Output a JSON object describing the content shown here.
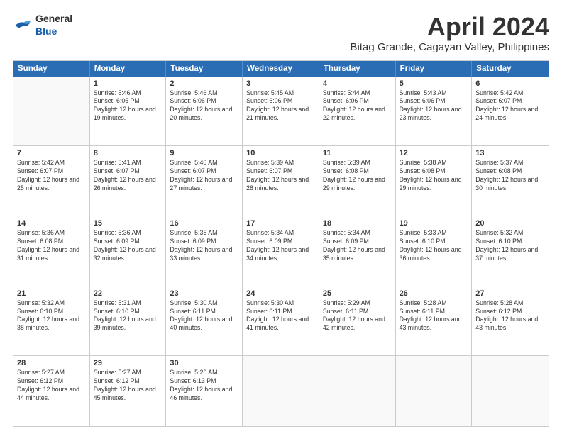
{
  "header": {
    "logo_general": "General",
    "logo_blue": "Blue",
    "month_year": "April 2024",
    "location": "Bitag Grande, Cagayan Valley, Philippines"
  },
  "days_of_week": [
    "Sunday",
    "Monday",
    "Tuesday",
    "Wednesday",
    "Thursday",
    "Friday",
    "Saturday"
  ],
  "weeks": [
    [
      {
        "day": "",
        "sunrise": "",
        "sunset": "",
        "daylight": ""
      },
      {
        "day": "1",
        "sunrise": "Sunrise: 5:46 AM",
        "sunset": "Sunset: 6:05 PM",
        "daylight": "Daylight: 12 hours and 19 minutes."
      },
      {
        "day": "2",
        "sunrise": "Sunrise: 5:46 AM",
        "sunset": "Sunset: 6:06 PM",
        "daylight": "Daylight: 12 hours and 20 minutes."
      },
      {
        "day": "3",
        "sunrise": "Sunrise: 5:45 AM",
        "sunset": "Sunset: 6:06 PM",
        "daylight": "Daylight: 12 hours and 21 minutes."
      },
      {
        "day": "4",
        "sunrise": "Sunrise: 5:44 AM",
        "sunset": "Sunset: 6:06 PM",
        "daylight": "Daylight: 12 hours and 22 minutes."
      },
      {
        "day": "5",
        "sunrise": "Sunrise: 5:43 AM",
        "sunset": "Sunset: 6:06 PM",
        "daylight": "Daylight: 12 hours and 23 minutes."
      },
      {
        "day": "6",
        "sunrise": "Sunrise: 5:42 AM",
        "sunset": "Sunset: 6:07 PM",
        "daylight": "Daylight: 12 hours and 24 minutes."
      }
    ],
    [
      {
        "day": "7",
        "sunrise": "Sunrise: 5:42 AM",
        "sunset": "Sunset: 6:07 PM",
        "daylight": "Daylight: 12 hours and 25 minutes."
      },
      {
        "day": "8",
        "sunrise": "Sunrise: 5:41 AM",
        "sunset": "Sunset: 6:07 PM",
        "daylight": "Daylight: 12 hours and 26 minutes."
      },
      {
        "day": "9",
        "sunrise": "Sunrise: 5:40 AM",
        "sunset": "Sunset: 6:07 PM",
        "daylight": "Daylight: 12 hours and 27 minutes."
      },
      {
        "day": "10",
        "sunrise": "Sunrise: 5:39 AM",
        "sunset": "Sunset: 6:07 PM",
        "daylight": "Daylight: 12 hours and 28 minutes."
      },
      {
        "day": "11",
        "sunrise": "Sunrise: 5:39 AM",
        "sunset": "Sunset: 6:08 PM",
        "daylight": "Daylight: 12 hours and 29 minutes."
      },
      {
        "day": "12",
        "sunrise": "Sunrise: 5:38 AM",
        "sunset": "Sunset: 6:08 PM",
        "daylight": "Daylight: 12 hours and 29 minutes."
      },
      {
        "day": "13",
        "sunrise": "Sunrise: 5:37 AM",
        "sunset": "Sunset: 6:08 PM",
        "daylight": "Daylight: 12 hours and 30 minutes."
      }
    ],
    [
      {
        "day": "14",
        "sunrise": "Sunrise: 5:36 AM",
        "sunset": "Sunset: 6:08 PM",
        "daylight": "Daylight: 12 hours and 31 minutes."
      },
      {
        "day": "15",
        "sunrise": "Sunrise: 5:36 AM",
        "sunset": "Sunset: 6:09 PM",
        "daylight": "Daylight: 12 hours and 32 minutes."
      },
      {
        "day": "16",
        "sunrise": "Sunrise: 5:35 AM",
        "sunset": "Sunset: 6:09 PM",
        "daylight": "Daylight: 12 hours and 33 minutes."
      },
      {
        "day": "17",
        "sunrise": "Sunrise: 5:34 AM",
        "sunset": "Sunset: 6:09 PM",
        "daylight": "Daylight: 12 hours and 34 minutes."
      },
      {
        "day": "18",
        "sunrise": "Sunrise: 5:34 AM",
        "sunset": "Sunset: 6:09 PM",
        "daylight": "Daylight: 12 hours and 35 minutes."
      },
      {
        "day": "19",
        "sunrise": "Sunrise: 5:33 AM",
        "sunset": "Sunset: 6:10 PM",
        "daylight": "Daylight: 12 hours and 36 minutes."
      },
      {
        "day": "20",
        "sunrise": "Sunrise: 5:32 AM",
        "sunset": "Sunset: 6:10 PM",
        "daylight": "Daylight: 12 hours and 37 minutes."
      }
    ],
    [
      {
        "day": "21",
        "sunrise": "Sunrise: 5:32 AM",
        "sunset": "Sunset: 6:10 PM",
        "daylight": "Daylight: 12 hours and 38 minutes."
      },
      {
        "day": "22",
        "sunrise": "Sunrise: 5:31 AM",
        "sunset": "Sunset: 6:10 PM",
        "daylight": "Daylight: 12 hours and 39 minutes."
      },
      {
        "day": "23",
        "sunrise": "Sunrise: 5:30 AM",
        "sunset": "Sunset: 6:11 PM",
        "daylight": "Daylight: 12 hours and 40 minutes."
      },
      {
        "day": "24",
        "sunrise": "Sunrise: 5:30 AM",
        "sunset": "Sunset: 6:11 PM",
        "daylight": "Daylight: 12 hours and 41 minutes."
      },
      {
        "day": "25",
        "sunrise": "Sunrise: 5:29 AM",
        "sunset": "Sunset: 6:11 PM",
        "daylight": "Daylight: 12 hours and 42 minutes."
      },
      {
        "day": "26",
        "sunrise": "Sunrise: 5:28 AM",
        "sunset": "Sunset: 6:11 PM",
        "daylight": "Daylight: 12 hours and 43 minutes."
      },
      {
        "day": "27",
        "sunrise": "Sunrise: 5:28 AM",
        "sunset": "Sunset: 6:12 PM",
        "daylight": "Daylight: 12 hours and 43 minutes."
      }
    ],
    [
      {
        "day": "28",
        "sunrise": "Sunrise: 5:27 AM",
        "sunset": "Sunset: 6:12 PM",
        "daylight": "Daylight: 12 hours and 44 minutes."
      },
      {
        "day": "29",
        "sunrise": "Sunrise: 5:27 AM",
        "sunset": "Sunset: 6:12 PM",
        "daylight": "Daylight: 12 hours and 45 minutes."
      },
      {
        "day": "30",
        "sunrise": "Sunrise: 5:26 AM",
        "sunset": "Sunset: 6:13 PM",
        "daylight": "Daylight: 12 hours and 46 minutes."
      },
      {
        "day": "",
        "sunrise": "",
        "sunset": "",
        "daylight": ""
      },
      {
        "day": "",
        "sunrise": "",
        "sunset": "",
        "daylight": ""
      },
      {
        "day": "",
        "sunrise": "",
        "sunset": "",
        "daylight": ""
      },
      {
        "day": "",
        "sunrise": "",
        "sunset": "",
        "daylight": ""
      }
    ]
  ]
}
